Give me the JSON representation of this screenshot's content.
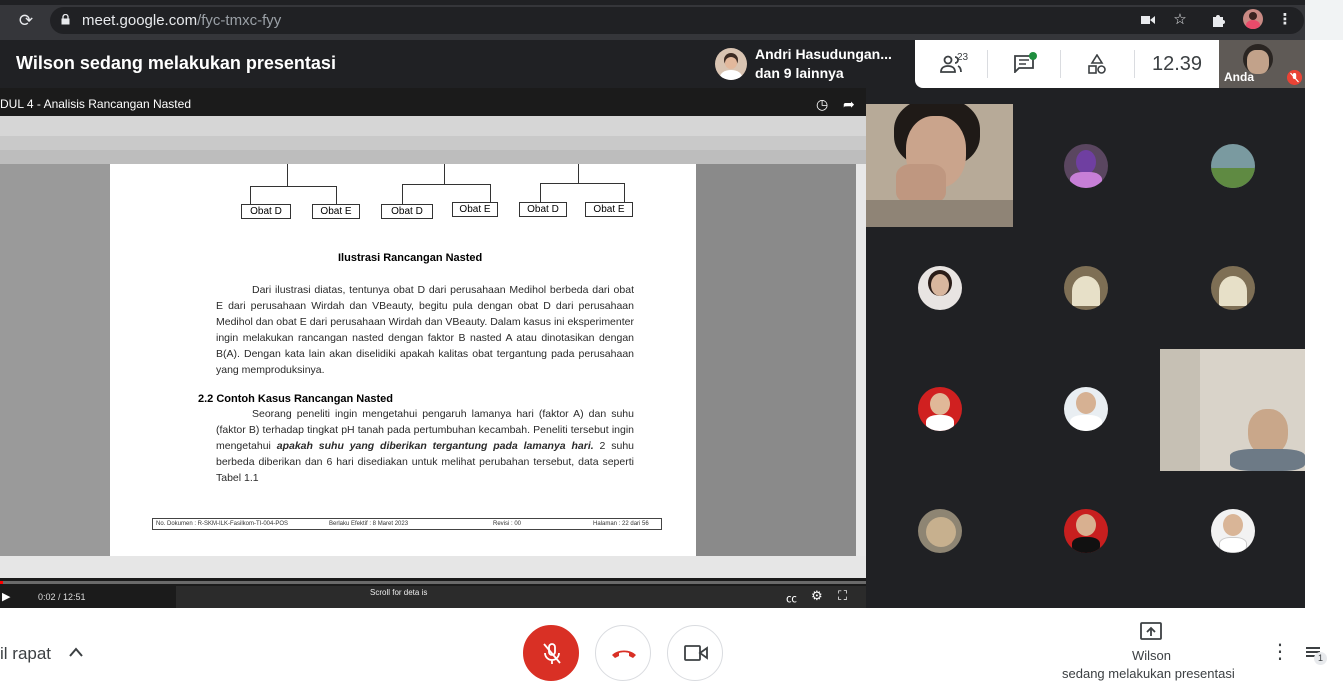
{
  "browser": {
    "url_host": "meet.google.com",
    "url_path": "/fyc-tmxc-fyy",
    "reload_icon": "reload-icon",
    "lock_icon": "lock-icon",
    "camera_icon": "camera-icon",
    "star_icon": "star-icon",
    "extensions_icon": "puzzle-icon",
    "menu_icon": "kebab-menu-icon"
  },
  "header": {
    "presenting_title": "Wilson sedang melakukan presentasi",
    "presenter_pill": {
      "line1": "Andri Hasudungan...",
      "line2": "dan 9 lainnya"
    },
    "participants_count": "23",
    "clock": "12.39",
    "self_label": "Anda"
  },
  "presentation": {
    "video_title": "DUL 4 - Analisis Rancangan Nasted",
    "time": "0:02 / 12:51",
    "progress_fraction": 0.003,
    "scroll_tip": "Scroll for deta is",
    "tree_boxes": [
      "Obat D",
      "Obat E",
      "Obat D",
      "Obat E",
      "Obat D",
      "Obat E"
    ],
    "heading": "Ilustrasi Rancangan Nasted",
    "paragraph1": "Dari ilustrasi diatas, tentunya obat D dari perusahaan Medihol berbeda dari obat E dari perusahaan Wirdah dan VBeauty, begitu pula dengan obat D dari perusahaan Medihol dan obat E dari perusahaan Wirdah dan VBeauty. Dalam kasus ini eksperimenter ingin melakukan rancangan nasted dengan faktor B nasted A atau dinotasikan dengan B(A). Dengan kata lain akan diselidiki apakah kalitas obat tergantung pada perusahaan yang memproduksinya.",
    "section_heading": "2.2 Contoh Kasus Rancangan Nasted",
    "paragraph2_a": "Seorang peneliti ingin mengetahui pengaruh lamanya hari (faktor A) dan suhu (faktor B) terhadap tingkat pH tanah pada pertumbuhan kecambah. Peneliti tersebut ingin mengetahui ",
    "paragraph2_em": "apakah suhu yang diberikan tergantung pada lamanya hari.",
    "paragraph2_b": " 2 suhu berbeda diberikan dan 6 hari disediakan untuk melihat perubahan tersebut, data seperti Tabel 1.1",
    "footer": {
      "doc_no": "No. Dokumen : R-SKM-ILK-Fasilkom-TI-004-POS",
      "berlaku": "Berlaku Efektif : 8 Maret 2023",
      "revisi": "Revisi : 00",
      "halaman": "Halaman : 22 dari 56"
    }
  },
  "bottom_bar": {
    "details_label": "il rapat",
    "presenter_name": "Wilson",
    "presenter_status": "sedang melakukan presentasi",
    "side_badge": "1"
  },
  "colors": {
    "meet_dark": "#202124",
    "end_call_red": "#d93025",
    "chat_dot": "#1e8e3e"
  }
}
